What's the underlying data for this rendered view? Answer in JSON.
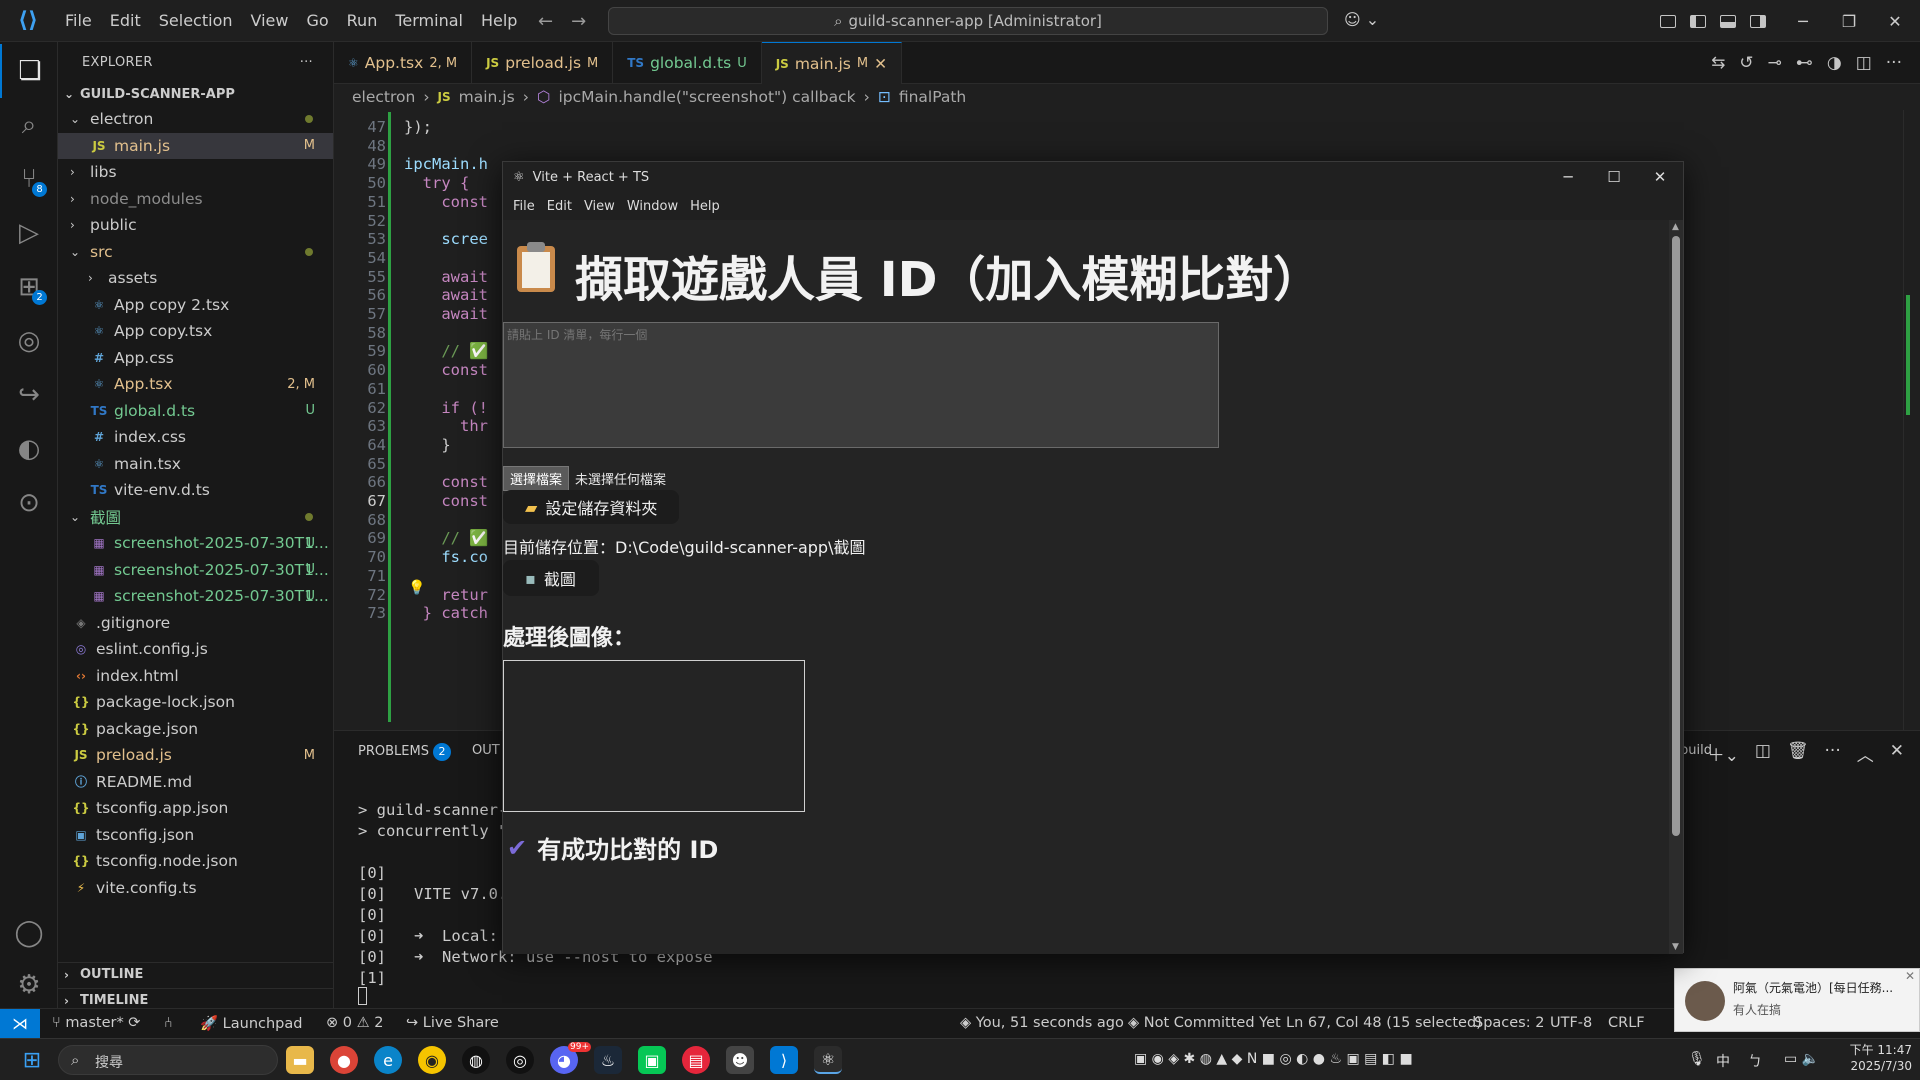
{
  "titlebar": {
    "menu": [
      "File",
      "Edit",
      "Selection",
      "View",
      "Go",
      "Run",
      "Terminal",
      "Help"
    ],
    "command_center": "guild-scanner-app [Administrator]"
  },
  "activity_badges": {
    "source_control": "8",
    "extensions": "2"
  },
  "explorer": {
    "title": "EXPLORER",
    "root": "GUILD-SCANNER-APP",
    "items": [
      {
        "label": "electron",
        "icon": "folder",
        "depth": 1,
        "open": true,
        "dot": true
      },
      {
        "label": "main.js",
        "icon": "JS",
        "depth": 2,
        "status": "M",
        "selected": true,
        "color": "#e2c08d"
      },
      {
        "label": "libs",
        "icon": "folder",
        "depth": 1,
        "open": false
      },
      {
        "label": "node_modules",
        "icon": "folder",
        "depth": 1,
        "open": false,
        "color": "#8c8c8c"
      },
      {
        "label": "public",
        "icon": "folder",
        "depth": 1,
        "open": false
      },
      {
        "label": "src",
        "icon": "folder",
        "depth": 1,
        "open": true,
        "dot": true,
        "color": "#e2c08d"
      },
      {
        "label": "assets",
        "icon": "folder",
        "depth": 2,
        "open": false
      },
      {
        "label": "App copy 2.tsx",
        "icon": "react",
        "depth": 2
      },
      {
        "label": "App copy.tsx",
        "icon": "react",
        "depth": 2
      },
      {
        "label": "App.css",
        "icon": "#",
        "depth": 2
      },
      {
        "label": "App.tsx",
        "icon": "react",
        "depth": 2,
        "status": "2, M",
        "color": "#e2c08d"
      },
      {
        "label": "global.d.ts",
        "icon": "TS",
        "depth": 2,
        "status": "U",
        "color": "#73c991"
      },
      {
        "label": "index.css",
        "icon": "#",
        "depth": 2
      },
      {
        "label": "main.tsx",
        "icon": "react",
        "depth": 2
      },
      {
        "label": "vite-env.d.ts",
        "icon": "TS",
        "depth": 2
      },
      {
        "label": "截圖",
        "icon": "folder",
        "depth": 1,
        "open": true,
        "dot": true,
        "color": "#73c991"
      },
      {
        "label": "screenshot-2025-07-30T1...",
        "icon": "img",
        "depth": 2,
        "status": "U",
        "color": "#73c991"
      },
      {
        "label": "screenshot-2025-07-30T1...",
        "icon": "img",
        "depth": 2,
        "status": "U",
        "color": "#73c991"
      },
      {
        "label": "screenshot-2025-07-30T1...",
        "icon": "img",
        "depth": 2,
        "status": "U",
        "color": "#73c991"
      },
      {
        "label": ".gitignore",
        "icon": "git",
        "depth": 1
      },
      {
        "label": "eslint.config.js",
        "icon": "eslint",
        "depth": 1
      },
      {
        "label": "index.html",
        "icon": "html",
        "depth": 1
      },
      {
        "label": "package-lock.json",
        "icon": "{}",
        "depth": 1
      },
      {
        "label": "package.json",
        "icon": "{}",
        "depth": 1
      },
      {
        "label": "preload.js",
        "icon": "JS",
        "depth": 1,
        "status": "M",
        "color": "#e2c08d"
      },
      {
        "label": "README.md",
        "icon": "info",
        "depth": 1
      },
      {
        "label": "tsconfig.app.json",
        "icon": "{}",
        "depth": 1
      },
      {
        "label": "tsconfig.json",
        "icon": "tsc",
        "depth": 1
      },
      {
        "label": "tsconfig.node.json",
        "icon": "{}",
        "depth": 1
      },
      {
        "label": "vite.config.ts",
        "icon": "vite",
        "depth": 1
      }
    ],
    "outline": "OUTLINE",
    "timeline": "TIMELINE"
  },
  "tabs": [
    {
      "name": "App.tsx",
      "status": "2, M",
      "icon": "react"
    },
    {
      "name": "preload.js",
      "status": "M",
      "icon": "JS"
    },
    {
      "name": "global.d.ts",
      "status": "U",
      "icon": "TS"
    },
    {
      "name": "main.js",
      "status": "M",
      "icon": "JS",
      "active": true
    }
  ],
  "breadcrumb": [
    "electron",
    "main.js",
    "ipcMain.handle(\"screenshot\") callback",
    "finalPath"
  ],
  "code_lines": [
    {
      "n": "47",
      "t": "});"
    },
    {
      "n": "48",
      "t": ""
    },
    {
      "n": "49",
      "t": "ipcMain.h"
    },
    {
      "n": "50",
      "t": "  try {"
    },
    {
      "n": "51",
      "t": "    const"
    },
    {
      "n": "52",
      "t": ""
    },
    {
      "n": "53",
      "t": "    scree"
    },
    {
      "n": "54",
      "t": ""
    },
    {
      "n": "55",
      "t": "    await"
    },
    {
      "n": "56",
      "t": "    await"
    },
    {
      "n": "57",
      "t": "    await"
    },
    {
      "n": "58",
      "t": ""
    },
    {
      "n": "59",
      "t": "    // ✅"
    },
    {
      "n": "60",
      "t": "    const"
    },
    {
      "n": "61",
      "t": ""
    },
    {
      "n": "62",
      "t": "    if (!"
    },
    {
      "n": "63",
      "t": "      thr"
    },
    {
      "n": "64",
      "t": "    }"
    },
    {
      "n": "65",
      "t": ""
    },
    {
      "n": "66",
      "t": "    const"
    },
    {
      "n": "67",
      "t": "    const"
    },
    {
      "n": "68",
      "t": ""
    },
    {
      "n": "69",
      "t": "    // ✅"
    },
    {
      "n": "70",
      "t": "    fs.co"
    },
    {
      "n": "71",
      "t": ""
    },
    {
      "n": "72",
      "t": "    retur"
    },
    {
      "n": "73",
      "t": "  } catch"
    }
  ],
  "panel": {
    "problems_label": "PROBLEMS",
    "problems_count": "2",
    "output_label": "OUT",
    "terminal_name": "build",
    "lines": [
      "> guild-scanner-",
      "> concurrently \"",
      "",
      "[0]",
      "[0]   VITE v7.0.",
      "[0]",
      "[0]   ➜  Local:",
      "[0]   ➜  Network: use --host to expose",
      "[1]"
    ]
  },
  "electron_window": {
    "title": "Vite + React + TS",
    "menu": [
      "File",
      "Edit",
      "View",
      "Window",
      "Help"
    ],
    "heading": "擷取遊戲人員 ID（加入模糊比對）",
    "textarea_placeholder": "請貼上 ID 清單，每行一個",
    "file_button": "選擇檔案",
    "file_status": "未選擇任何檔案",
    "set_folder_button": "設定儲存資料夾",
    "save_path_label": "目前儲存位置：D:\\Code\\guild-scanner-app\\截圖",
    "screenshot_button": "截圖",
    "processed_heading": "處理後圖像：",
    "matched_heading": "有成功比對的 ID"
  },
  "statusbar": {
    "branch": "master*",
    "launchpad": "Launchpad",
    "errors": "0",
    "warnings": "2",
    "live_share": "Live Share",
    "blame": "You, 51 seconds ago",
    "commit": "Not Committed Yet",
    "position": "Ln 67, Col 48 (15 selected)",
    "spaces": "Spaces: 2",
    "encoding": "UTF-8",
    "eol": "CRLF"
  },
  "notification": {
    "title": "阿氣（元氣電池）[每日任務...",
    "body": "有人在搞"
  },
  "taskbar": {
    "search": "搜尋",
    "time": "下午 11:47",
    "date": "2025/7/30",
    "ime": "中",
    "discord_badge": "99+"
  }
}
